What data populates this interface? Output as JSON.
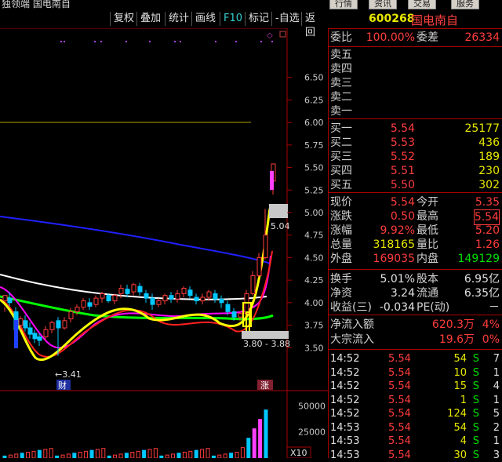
{
  "topbar": {
    "app_title": "独领端  国电南自",
    "buttons": [
      "行情",
      "资讯",
      "交易",
      "服务"
    ]
  },
  "toolbar": {
    "items": [
      "复权",
      "叠加",
      "统计",
      "画线",
      "F10",
      "标记",
      "-自选",
      "返回"
    ]
  },
  "chart": {
    "price_ticks": [
      "6.50",
      "6.25",
      "6.00",
      "5.75",
      "5.50",
      "5.25",
      "5.00",
      "4.75",
      "4.50",
      "4.25",
      "4.00",
      "3.75",
      "3.50"
    ],
    "price_tick_values": [
      6.5,
      6.25,
      6.0,
      5.75,
      5.5,
      5.25,
      5.0,
      4.75,
      4.5,
      4.25,
      4.0,
      3.75,
      3.5
    ],
    "volume_ticks": [
      "50000",
      "25000"
    ],
    "volume_tick_values": [
      50000,
      25000
    ],
    "volume_multiplier": "X10",
    "label_low": "←3.41",
    "label_high": "5.04",
    "label_range": "3.80 - 3.88",
    "marker_cai": "财",
    "marker_zhang": "涨",
    "colors": {
      "ma5": "#ffffff",
      "ma10": "#ffff00",
      "ma20": "#ff00ff",
      "ma30": "#00ff00",
      "ma60": "#d0d0d0",
      "ma120": "#2020ff",
      "up": "#ff3c3c",
      "down": "#00ffff",
      "hline": "#b0a000"
    }
  },
  "stock": {
    "code": "600268",
    "name": "国电南自"
  },
  "quote": {
    "weibi_label": "委比",
    "weibi": "100.00%",
    "weicha_label": "委差",
    "weicha": "26334",
    "sell": [
      {
        "label": "卖五",
        "price": "",
        "vol": ""
      },
      {
        "label": "卖四",
        "price": "",
        "vol": ""
      },
      {
        "label": "卖三",
        "price": "",
        "vol": ""
      },
      {
        "label": "卖二",
        "price": "",
        "vol": ""
      },
      {
        "label": "卖一",
        "price": "",
        "vol": ""
      }
    ],
    "buy": [
      {
        "label": "买一",
        "price": "5.54",
        "vol": "25177"
      },
      {
        "label": "买二",
        "price": "5.53",
        "vol": "436"
      },
      {
        "label": "买三",
        "price": "5.52",
        "vol": "189"
      },
      {
        "label": "买四",
        "price": "5.51",
        "vol": "230"
      },
      {
        "label": "买五",
        "price": "5.50",
        "vol": "302"
      }
    ],
    "stats": [
      {
        "l1": "现价",
        "v1": "5.54",
        "l2": "今开",
        "v2": "5.35"
      },
      {
        "l1": "涨跌",
        "v1": "0.50",
        "l2": "最高",
        "v2": "5.54"
      },
      {
        "l1": "涨幅",
        "v1": "9.92%",
        "l2": "最低",
        "v2": "5.20"
      },
      {
        "l1": "总量",
        "v1": "318165",
        "l2": "量比",
        "v2": "1.26"
      },
      {
        "l1": "外盘",
        "v1": "169035",
        "l2": "内盘",
        "v2": "149129"
      }
    ],
    "fund": [
      {
        "l1": "换手",
        "v1": "5.01%",
        "l2": "股本",
        "v2": "6.95亿"
      },
      {
        "l1": "净资",
        "v1": "3.24",
        "l2": "流通",
        "v2": "6.35亿"
      },
      {
        "l1": "收益(三)",
        "v1": "-0.034",
        "l2": "PE(动)",
        "v2": "－"
      }
    ],
    "flow": [
      {
        "label": "净流入额",
        "value": "620.3万",
        "pct": "4%"
      },
      {
        "label": "大宗流入",
        "value": "19.6万",
        "pct": "0%"
      }
    ],
    "ticks": [
      {
        "time": "14:52",
        "price": "5.54",
        "vol": "54",
        "bs": "S",
        "n": "7"
      },
      {
        "time": "14:52",
        "price": "5.54",
        "vol": "10",
        "bs": "S",
        "n": "1"
      },
      {
        "time": "14:52",
        "price": "5.54",
        "vol": "15",
        "bs": "S",
        "n": "4"
      },
      {
        "time": "14:52",
        "price": "5.54",
        "vol": "1",
        "bs": "S",
        "n": "1"
      },
      {
        "time": "14:52",
        "price": "5.54",
        "vol": "124",
        "bs": "S",
        "n": "5"
      },
      {
        "time": "14:53",
        "price": "5.54",
        "vol": "54",
        "bs": "S",
        "n": "2"
      },
      {
        "time": "14:53",
        "price": "5.54",
        "vol": "4",
        "bs": "S",
        "n": "1"
      },
      {
        "time": "14:53",
        "price": "5.54",
        "vol": "30",
        "bs": "S",
        "n": "3"
      }
    ]
  }
}
